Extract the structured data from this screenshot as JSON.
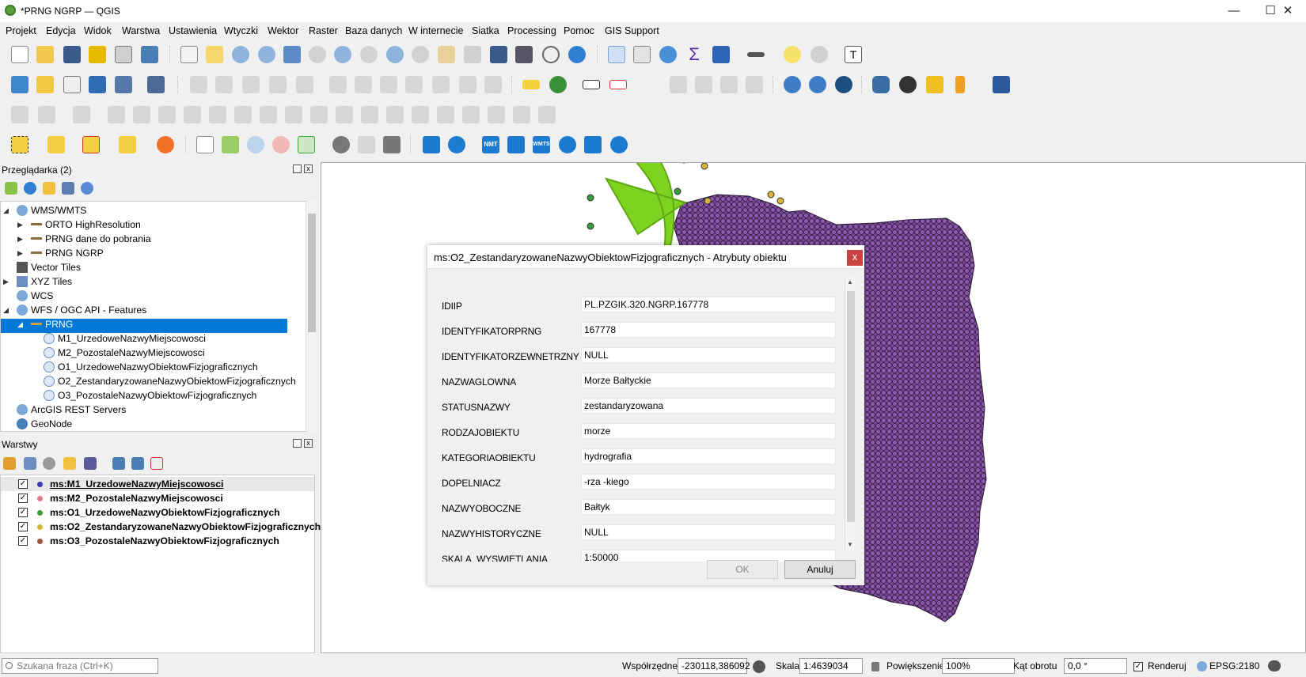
{
  "window": {
    "title": "*PRNG NGRP — QGIS",
    "minimize": "—",
    "maximize": "☐",
    "close": "✕"
  },
  "menu": [
    "Projekt",
    "Edycja",
    "Widok",
    "Warstwa",
    "Ustawienia",
    "Wtyczki",
    "Wektor",
    "Raster",
    "Baza danych",
    "W internecie",
    "Siatka",
    "Processing",
    "Pomoc",
    "GIS Support"
  ],
  "toolbar_labels": {
    "nmt": "NMT",
    "wmts": "WMTS"
  },
  "browser": {
    "title": "Przeglądarka (2)",
    "items": [
      {
        "label": "WMS/WMTS",
        "expanded": true
      },
      {
        "label": "ORTO HighResolution"
      },
      {
        "label": "PRNG dane do pobrania"
      },
      {
        "label": "PRNG NGRP"
      },
      {
        "label": "Vector Tiles"
      },
      {
        "label": "XYZ Tiles"
      },
      {
        "label": "WCS"
      },
      {
        "label": "WFS / OGC API - Features",
        "expanded": true
      },
      {
        "label": "PRNG",
        "selected": true
      },
      {
        "label": "M1_UrzedoweNazwyMiejscowosci"
      },
      {
        "label": "M2_PozostaleNazwyMiejscowosci"
      },
      {
        "label": "O1_UrzedoweNazwyObiektowFizjograficznych"
      },
      {
        "label": "O2_ZestandaryzowaneNazwyObiektowFizjograficznych"
      },
      {
        "label": "O3_PozostaleNazwyObiektowFizjograficznych"
      },
      {
        "label": "ArcGIS REST Servers"
      },
      {
        "label": "GeoNode"
      }
    ]
  },
  "layers": {
    "title": "Warstwy",
    "items": [
      {
        "name": "ms:M1_UrzedoweNazwyMiejscowosci",
        "checked": true,
        "color": "#3b3bb0"
      },
      {
        "name": "ms:M2_PozostaleNazwyMiejscowosci",
        "checked": true,
        "color": "#e07a8c"
      },
      {
        "name": "ms:O1_UrzedoweNazwyObiektowFizjograficznych",
        "checked": true,
        "color": "#3f9a3f"
      },
      {
        "name": "ms:O2_ZestandaryzowaneNazwyObiektowFizjograficznych",
        "checked": true,
        "color": "#d7b53a"
      },
      {
        "name": "ms:O3_PozostaleNazwyObiektowFizjograficznych",
        "checked": true,
        "color": "#a2524a"
      }
    ]
  },
  "dialog": {
    "title": "ms:O2_ZestandaryzowaneNazwyObiektowFizjograficznych - Atrybuty obiektu",
    "close": "x",
    "fields": [
      {
        "label": "IDIIP",
        "value": "PL.PZGIK.320.NGRP.167778"
      },
      {
        "label": "IDENTYFIKATORPRNG",
        "value": "167778"
      },
      {
        "label": "IDENTYFIKATORZEWNETRZNY",
        "value": "NULL"
      },
      {
        "label": "NAZWAGLOWNA",
        "value": "Morze Bałtyckie"
      },
      {
        "label": "STATUSNAZWY",
        "value": "zestandaryzowana"
      },
      {
        "label": "RODZAJOBIEKTU",
        "value": "morze"
      },
      {
        "label": "KATEGORIAOBIEKTU",
        "value": "hydrografia"
      },
      {
        "label": "DOPELNIACZ",
        "value": "-rza -kiego"
      },
      {
        "label": "NAZWYOBOCZNE",
        "value": "Bałtyk"
      },
      {
        "label": "NAZWYHISTORYCZNE",
        "value": "NULL"
      },
      {
        "label": "SKALA_WYSWIETLANIA",
        "value": "1:50000"
      }
    ],
    "ok": "OK",
    "cancel": "Anuluj"
  },
  "status": {
    "search_placeholder": "Szukana fraza (Ctrl+K)",
    "coord_label": "Współrzędne",
    "coord_value": "-230118,386092",
    "scale_label": "Skala",
    "scale_value": "1:4639034",
    "zoom_label": "Powiększenie",
    "zoom_value": "100%",
    "rotation_label": "Kąt obrotu",
    "rotation_value": "0,0 °",
    "render_label": "Renderuj",
    "crs": "EPSG:2180"
  },
  "colors": {
    "polygon": "#7d4a9c",
    "selection": "#0078d7",
    "arrow": "#7ed321"
  }
}
